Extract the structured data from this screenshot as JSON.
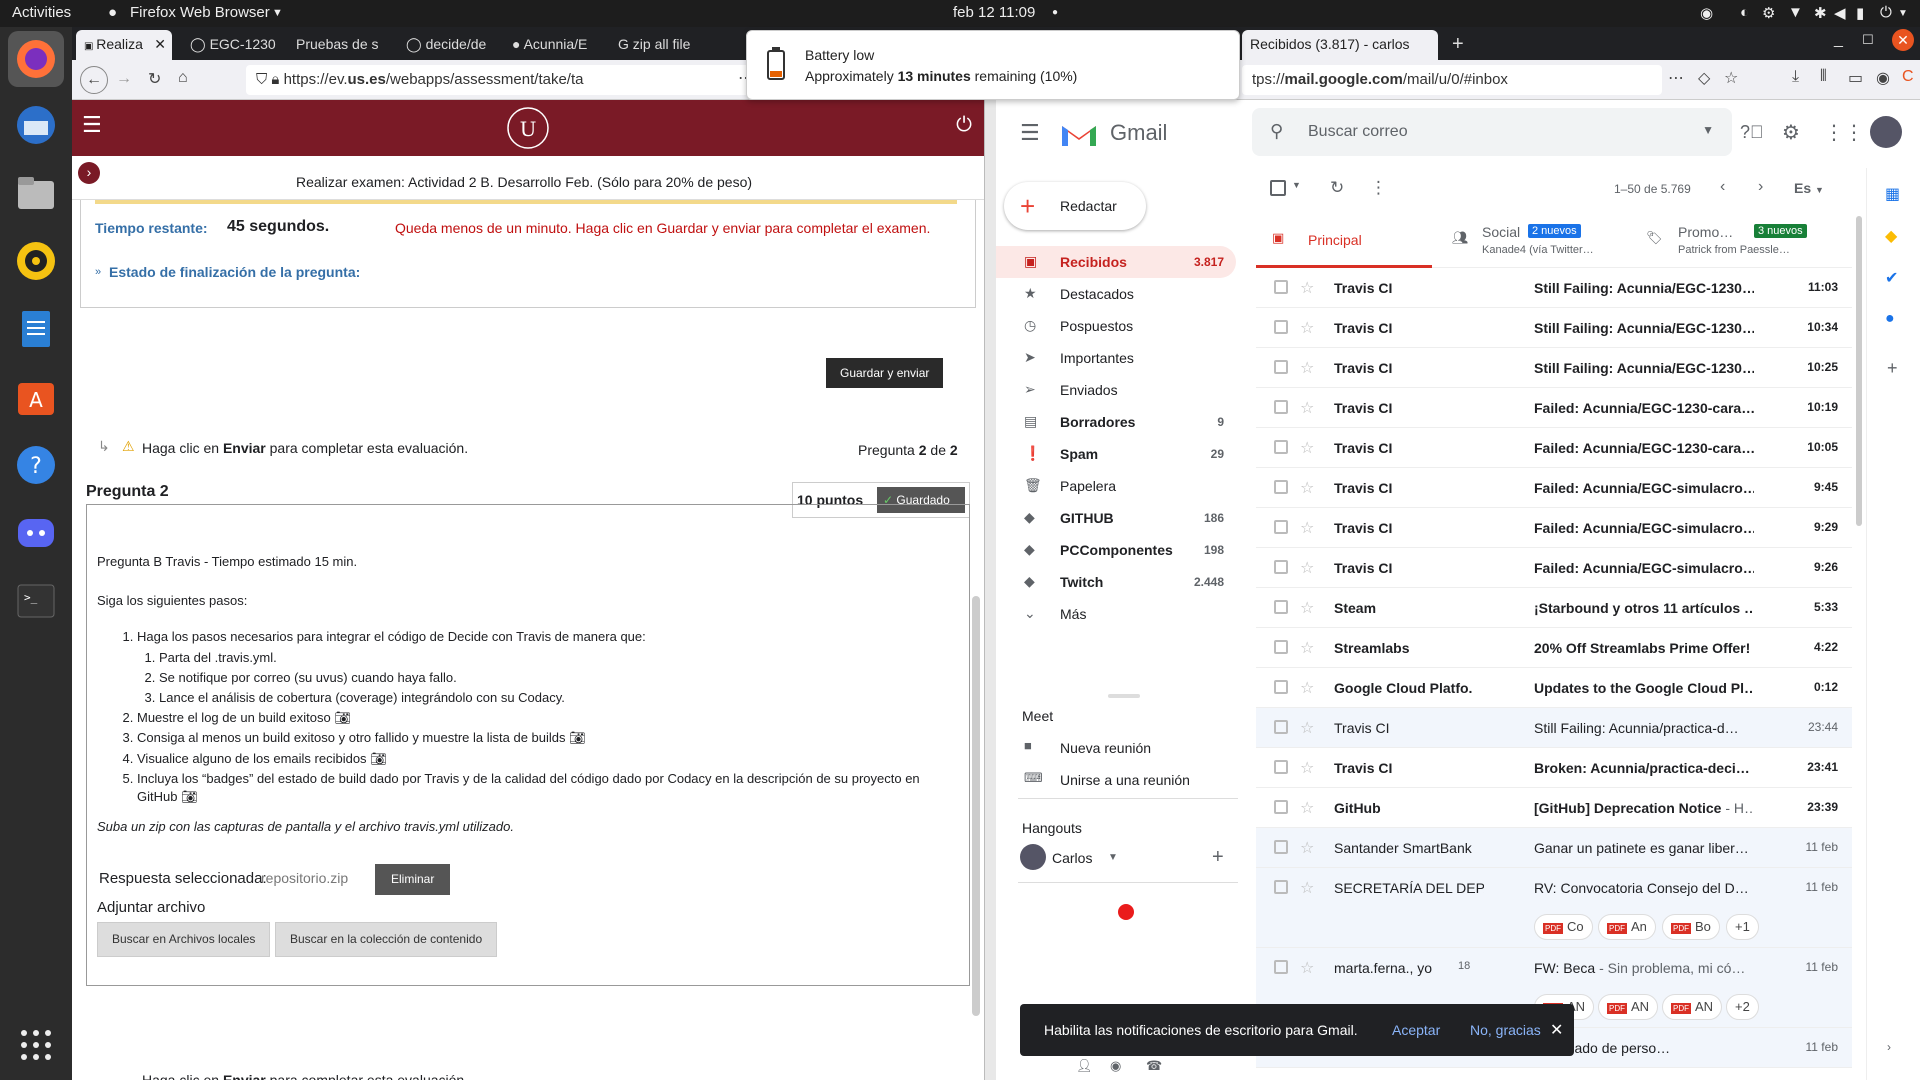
{
  "system": {
    "activities": "Activities",
    "app_name": "Firefox Web Browser",
    "clock": "feb 12  11:09"
  },
  "notification": {
    "title": "Battery low",
    "body_prefix": "Approximately ",
    "body_bold": "13 minutes",
    "body_suffix": " remaining (10%)"
  },
  "browser": {
    "tabs": [
      {
        "label": "Realiza",
        "active": true
      },
      {
        "label": "EGC-1230"
      },
      {
        "label": "Pruebas de s"
      },
      {
        "label": "decide/de"
      },
      {
        "label": "Acunnia/E"
      },
      {
        "label": "zip all file"
      },
      {
        "label": "Recibidos (3.817) - carlos",
        "active": true
      }
    ],
    "url_left_prefix": "https://ev.",
    "url_left_domain": "us.es",
    "url_left_suffix": "/webapps/assessment/take/ta",
    "url_right_prefix": "tps://",
    "url_right_domain": "mail.google.com",
    "url_right_suffix": "/mail/u/0/#inbox"
  },
  "exam": {
    "header_title": "Realizar examen: Actividad 2 B. Desarrollo Feb. (Sólo para 20% de peso)",
    "time_label": "Tiempo restante:",
    "time_value": "45 segundos.",
    "warning": "Queda menos de un minuto. Haga clic en Guardar y enviar para completar el examen.",
    "status_link": "Estado de finalización de la pregunta:",
    "save_submit": "Guardar y enviar",
    "instruction_prefix": "Haga clic en ",
    "instruction_bold": "Enviar",
    "instruction_suffix": " para completar esta evaluación.",
    "question_label": "Pregunta",
    "question_current": "2",
    "question_of": "de",
    "question_total": "2",
    "question_title": "Pregunta 2",
    "points": "10 puntos",
    "saved": "Guardado",
    "question_heading": "Pregunta B Travis - Tiempo estimado 15 min.",
    "steps_intro": "Siga los siguientes pasos:",
    "step1": "Haga los pasos necesarios para integrar el código de Decide con Travis de manera que:",
    "step1_sub": [
      "Parta del .travis.yml.",
      "Se notifique por correo (su uvus) cuando haya fallo.",
      "Lance el análisis de cobertura (coverage) integrándolo con su Codacy."
    ],
    "step2": "Muestre el log de un build exitoso",
    "step3": "Consiga al menos un build exitoso y otro fallido y muestre la lista de builds",
    "step4": "Visualice alguno de los emails recibidos",
    "step5": "Incluya los “badges” del estado de build dado por Travis y de la calidad del código dado por Codacy en la descripción de su proyecto en GitHub",
    "upload_note": "Suba un zip con las capturas de pantalla y el archivo travis.yml utilizado.",
    "selected_label": "Respuesta seleccionada:",
    "selected_file": "repositorio.zip",
    "remove": "Eliminar",
    "attach_label": "Adjuntar archivo",
    "browse_local": "Buscar en Archivos locales",
    "browse_collection": "Buscar en la colección de contenido",
    "bottom_partial_prefix": "Haga clic en ",
    "bottom_partial_bold": "Enviar",
    "bottom_partial_suffix": " para completar esta evaluación."
  },
  "gmail": {
    "logo": "Gmail",
    "search_placeholder": "Buscar correo",
    "compose": "Redactar",
    "pagination": "1–50 de 5.769",
    "lang": "Es",
    "tabs": {
      "primary": "Principal",
      "social": "Social",
      "social_badge": "2 nuevos",
      "social_sub": "Kanade4 (vía Twitter…",
      "promo": "Promo…",
      "promo_badge": "3 nuevos",
      "promo_sub": "Patrick from Paessle…"
    },
    "sidebar": [
      {
        "label": "Recibidos",
        "count": "3.817",
        "icon": "inbox-icon"
      },
      {
        "label": "Destacados",
        "count": "",
        "icon": "star-icon"
      },
      {
        "label": "Pospuestos",
        "count": "",
        "icon": "clock-icon"
      },
      {
        "label": "Importantes",
        "count": "",
        "icon": "important-icon"
      },
      {
        "label": "Enviados",
        "count": "",
        "icon": "send-icon"
      },
      {
        "label": "Borradores",
        "count": "9",
        "icon": "draft-icon"
      },
      {
        "label": "Spam",
        "count": "29",
        "icon": "spam-icon"
      },
      {
        "label": "Papelera",
        "count": "",
        "icon": "trash-icon"
      },
      {
        "label": "GITHUB",
        "count": "186",
        "icon": "label-icon"
      },
      {
        "label": "PCComponentes",
        "count": "198",
        "icon": "label-icon"
      },
      {
        "label": "Twitch",
        "count": "2.448",
        "icon": "label-icon"
      },
      {
        "label": "Más",
        "count": "",
        "icon": "chevron-down-icon"
      }
    ],
    "meet": {
      "title": "Meet",
      "new": "Nueva reunión",
      "join": "Unirse a una reunión"
    },
    "hangouts": {
      "title": "Hangouts",
      "user": "Carlos"
    },
    "emails": [
      {
        "from": "Travis CI",
        "subject": "Still Failing: Acunnia/EGC-1230…",
        "snippet": "",
        "time": "11:03",
        "unread": true
      },
      {
        "from": "Travis CI",
        "subject": "Still Failing: Acunnia/EGC-1230…",
        "snippet": "",
        "time": "10:34",
        "unread": true
      },
      {
        "from": "Travis CI",
        "subject": "Still Failing: Acunnia/EGC-1230…",
        "snippet": "",
        "time": "10:25",
        "unread": true
      },
      {
        "from": "Travis CI",
        "subject": "Failed: Acunnia/EGC-1230-cara…",
        "snippet": "",
        "time": "10:19",
        "unread": true
      },
      {
        "from": "Travis CI",
        "subject": "Failed: Acunnia/EGC-1230-cara…",
        "snippet": "",
        "time": "10:05",
        "unread": true
      },
      {
        "from": "Travis CI",
        "subject": "Failed: Acunnia/EGC-simulacro…",
        "snippet": "",
        "time": "9:45",
        "unread": true
      },
      {
        "from": "Travis CI",
        "subject": "Failed: Acunnia/EGC-simulacro…",
        "snippet": "",
        "time": "9:29",
        "unread": true
      },
      {
        "from": "Travis CI",
        "subject": "Failed: Acunnia/EGC-simulacro…",
        "snippet": "",
        "time": "9:26",
        "unread": true
      },
      {
        "from": "Steam",
        "subject": "¡Starbound y otros 11 artículos …",
        "snippet": "",
        "time": "5:33",
        "unread": true
      },
      {
        "from": "Streamlabs",
        "subject": "20% Off Streamlabs Prime Offer!",
        "snippet": "",
        "time": "4:22",
        "unread": true
      },
      {
        "from": "Google Cloud Platfo.",
        "subject": "Updates to the Google Cloud Pl…",
        "snippet": "",
        "time": "0:12",
        "unread": true
      },
      {
        "from": "Travis CI",
        "subject": "Still Failing: Acunnia/practica-d…",
        "snippet": "",
        "time": "23:44",
        "unread": false
      },
      {
        "from": "Travis CI",
        "subject": "Broken: Acunnia/practica-deci…",
        "snippet": "",
        "time": "23:41",
        "unread": true
      },
      {
        "from": "GitHub",
        "subject": "[GitHub] Deprecation Notice",
        "snippet": " - H…",
        "time": "23:39",
        "unread": true
      },
      {
        "from": "Santander SmartBank",
        "subject": "Ganar un patinete es ganar liber…",
        "snippet": "",
        "time": "11 feb",
        "unread": false
      },
      {
        "from": "SECRETARÍA DEL DEPA.",
        "subject": "RV: Convocatoria Consejo del D…",
        "snippet": "",
        "time": "11 feb",
        "unread": false
      }
    ],
    "attach_row1": [
      "Co",
      "An",
      "Bo",
      "+1"
    ],
    "row_marta": {
      "from": "marta.ferna., yo",
      "count": "18",
      "subject": "FW: Beca",
      "snippet": " - Sin problema, mi có…",
      "time": "11 feb"
    },
    "attach_row2": [
      "AN",
      "AN",
      "AN",
      "+2"
    ],
    "row_last": {
      "subject": "certificado de perso…",
      "time": "11 feb"
    },
    "toast": {
      "text": "Habilita las notificaciones de escritorio para Gmail.",
      "accept": "Aceptar",
      "decline": "No, gracias"
    }
  }
}
